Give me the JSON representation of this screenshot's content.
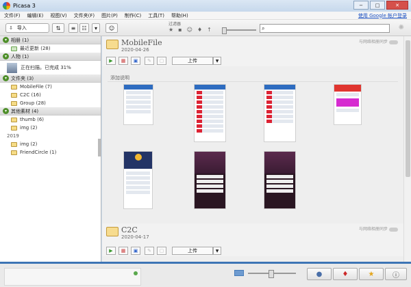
{
  "window": {
    "title": "Picasa 3",
    "minimize": "−",
    "maximize": "□",
    "close": "✕"
  },
  "menu": {
    "items": [
      "文件(F)",
      "编辑(E)",
      "视图(V)",
      "文件夹(F)",
      "图片(P)",
      "制作(C)",
      "工具(T)",
      "帮助(H)"
    ],
    "login": "使用 Google 帐户登录"
  },
  "toolbar": {
    "import_label": "导入",
    "filter_label": "过滤器",
    "search_value": "",
    "icons": [
      "import-icon",
      "upload-people-icon",
      "list-view-icon",
      "grid-view-icon",
      "dropdown-icon",
      "people-view-icon",
      "star-filter-icon",
      "video-filter-icon",
      "face-filter-icon",
      "geo-filter-icon",
      "upload-filter-icon",
      "search-icon",
      "gear-icon"
    ]
  },
  "sidebar": {
    "sections": [
      {
        "title": "相册 (1)",
        "items": [
          {
            "label": "最近更新 (28)"
          }
        ]
      },
      {
        "title": "人物 (1)",
        "items": [
          {
            "label": "正在扫描。已完成 31%"
          }
        ]
      },
      {
        "title": "文件夹 (3)",
        "items": [
          {
            "label": "MobileFile (7)"
          },
          {
            "label": "C2C (16)"
          },
          {
            "label": "Group (28)"
          }
        ]
      },
      {
        "title": "其他素材 (4)",
        "items": [
          {
            "label": "thumb (6)"
          },
          {
            "label": "img (2)"
          }
        ]
      }
    ],
    "year": "2019",
    "year_items": [
      {
        "label": "img (2)"
      },
      {
        "label": "FriendCircle (1)"
      }
    ]
  },
  "albums": [
    {
      "name": "MobileFile",
      "date": "2020-04-26",
      "sync_label": "与网络相册同步",
      "upload_label": "上传",
      "caption": "添加说明"
    },
    {
      "name": "C2C",
      "date": "2020-04-17",
      "sync_label": "与网络相册同步",
      "upload_label": "上传"
    }
  ],
  "bottom": {
    "icons": [
      "zoom-icon",
      "people-icon",
      "map-pin-icon",
      "star-icon",
      "info-icon"
    ]
  }
}
